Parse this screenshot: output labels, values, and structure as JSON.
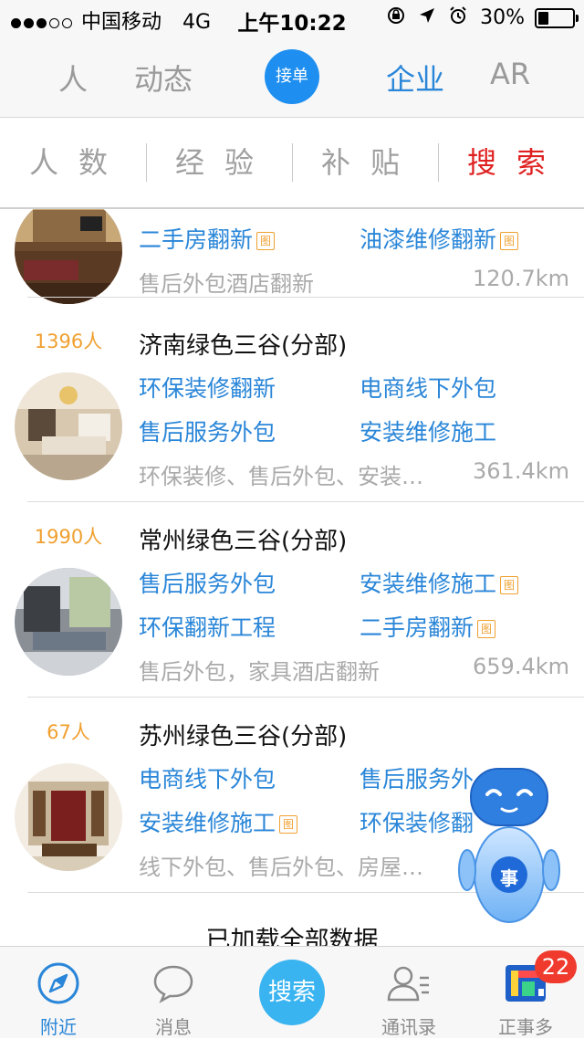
{
  "status_bar": {
    "carrier": "中国移动",
    "network": "4G",
    "time": "上午10:22",
    "battery": "30%",
    "battery_level": 0.3,
    "signal_bars": 3
  },
  "top_nav": {
    "items": [
      "人",
      "动态",
      "企业",
      "AR"
    ],
    "center_label": "接单",
    "active": "企业",
    "accent_color": "#2a86d8"
  },
  "filter_bar": {
    "items": [
      "人数",
      "经验",
      "补贴",
      "搜索"
    ]
  },
  "list": {
    "items": [
      {
        "count": "",
        "title": "",
        "tags": [
          {
            "text": "二手房翻新",
            "has_image": true
          },
          {
            "text": "油漆维修翻新",
            "has_image": true
          }
        ],
        "description": "售后外包酒店翻新",
        "distance": "120.7km"
      },
      {
        "count": "1396人",
        "title": "济南绿色三谷(分部)",
        "tags": [
          {
            "text": "环保装修翻新",
            "has_image": false
          },
          {
            "text": "电商线下外包",
            "has_image": false
          },
          {
            "text": "售后服务外包",
            "has_image": false
          },
          {
            "text": "安装维修施工",
            "has_image": false
          }
        ],
        "description": "环保装修、售后外包、安装…",
        "distance": "361.4km"
      },
      {
        "count": "1990人",
        "title": "常州绿色三谷(分部)",
        "tags": [
          {
            "text": "售后服务外包",
            "has_image": false
          },
          {
            "text": "安装维修施工",
            "has_image": true
          },
          {
            "text": "环保翻新工程",
            "has_image": false
          },
          {
            "text": "二手房翻新",
            "has_image": true
          }
        ],
        "description": "售后外包，家具酒店翻新",
        "distance": "659.4km"
      },
      {
        "count": "67人",
        "title": "苏州绿色三谷(分部)",
        "tags": [
          {
            "text": "电商线下外包",
            "has_image": false
          },
          {
            "text": "售后服务外",
            "has_image": false
          },
          {
            "text": "安装维修施工",
            "has_image": true
          },
          {
            "text": "环保装修翻",
            "has_image": false
          }
        ],
        "description": "线下外包、售后外包、房屋…",
        "distance": ""
      }
    ],
    "footer": "已加载全部数据"
  },
  "image_badge_label": "图",
  "robot_label": "事",
  "tab_bar": {
    "tabs": [
      {
        "label": "附近",
        "icon": "compass-icon"
      },
      {
        "label": "消息",
        "icon": "chat-bubble-icon"
      },
      {
        "label": "通讯录",
        "icon": "contacts-icon"
      },
      {
        "label": "正事多",
        "icon": "app-logo-icon"
      }
    ],
    "center_label": "搜索",
    "badge_count": "22"
  }
}
